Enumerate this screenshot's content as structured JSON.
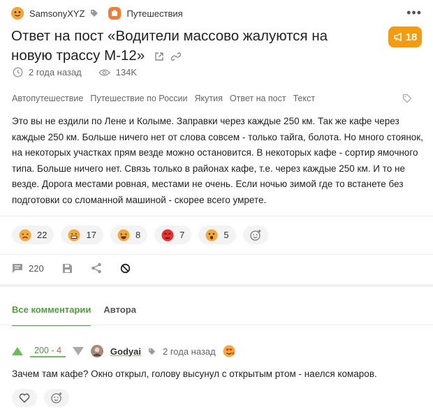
{
  "header": {
    "author": "SamsonyXYZ",
    "community": "Путешествия",
    "more_glyph": "•••"
  },
  "post": {
    "title": "Ответ на пост «Водители массово жалуются на новую трассу М-12»",
    "rating": "18",
    "time": "2 года назад",
    "views": "134K",
    "tags": [
      "Автопутешествие",
      "Путешествие по России",
      "Якутия",
      "Ответ на пост",
      "Текст"
    ],
    "body": "Это вы не ездили по Лене и Колыме. Заправки через каждые 250 км. Так же кафе через каждые 250 км. Больше ничего нет от слова совсем - только тайга, болота. Но много стоянок, на некоторых участках прям везде можно остановится. В некоторых кафе - сортир ямочного типа. Больше ничего нет. Связь только в районах кафе, т.е. через каждые 250 км. И то не везде. Дорога местами ровная, местами не очень. Если ночью зимой где то встанете без подготовки со сломанной машиной - скорее всего умрете."
  },
  "reactions": [
    {
      "icon": "tired-face-icon",
      "count": "22"
    },
    {
      "icon": "grin-sweat-icon",
      "count": "17"
    },
    {
      "icon": "laughing-face-icon",
      "count": "8"
    },
    {
      "icon": "angry-face-icon",
      "count": "7"
    },
    {
      "icon": "scared-face-icon",
      "count": "5"
    }
  ],
  "actions": {
    "comments_count": "220"
  },
  "tabs": {
    "all": "Все комментарии",
    "author": "Автора"
  },
  "comment": {
    "score_plus": "200",
    "score_sep": " - ",
    "score_minus": "4",
    "author": "Godyai",
    "time": "2 года назад",
    "text": "Зачем там кафе? Окно открыл, голову высунул с открытым ртом - наелся комаров."
  },
  "colors": {
    "accent_green": "#4e9f3d",
    "rating_orange": "#f59b0f",
    "downvote_red": "#d65b4a"
  }
}
